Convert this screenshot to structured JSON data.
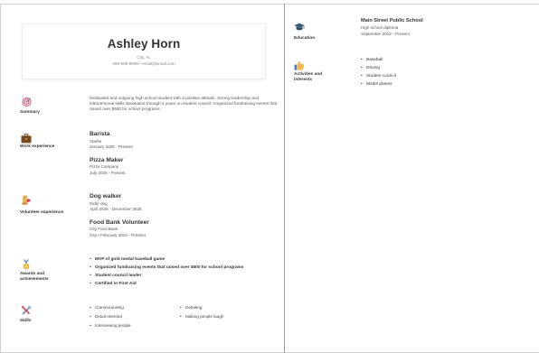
{
  "header": {
    "name": "Ashley Horn",
    "location": "City, AL",
    "contact": "999-999-9999  •  email@email.com"
  },
  "summary": {
    "title": "Summary",
    "icon": "target-icon",
    "text": "Dedicated and outgoing high school student with a positive attitude. Strong leadership and interpersonal skills developed through 2 years on student council. Organized fundraising events that raised over $500 for school programs."
  },
  "work": {
    "title": "Work experience",
    "icon": "briefcase-icon",
    "jobs": [
      {
        "role": "Barista",
        "company": "Starbs",
        "dates": "January 2026 - Present"
      },
      {
        "role": "Pizza Maker",
        "company": "Pizza Company",
        "dates": "July 2025 - Present"
      }
    ]
  },
  "volunteer": {
    "title": "Volunteer experience",
    "icon": "volunteer-hand-icon",
    "jobs": [
      {
        "role": "Dog walker",
        "company": "Elder dog",
        "dates": "April 2025 - December 2025"
      },
      {
        "role": "Food Bank Volunteer",
        "company": "City Food Bank",
        "dates": "City  •  February 2024 - Present"
      }
    ]
  },
  "awards": {
    "title": "Awards and achievements",
    "icon": "medal-icon",
    "items": [
      "MVP of gold medal baseball game",
      "Organized fundraising events that raised over $500 for school programs",
      "Student council leader",
      "Certified in First Aid"
    ]
  },
  "skills": {
    "title": "Skills",
    "icon": "tools-icon",
    "items": [
      "Communicating",
      "Debating",
      "Detail-oriented",
      "Making people laugh",
      "Interviewing people"
    ]
  },
  "education": {
    "title": "Education",
    "icon": "graduation-cap-icon",
    "school": "Main Street Public School",
    "degree": "High school diploma",
    "dates": "September 2022 - Present"
  },
  "activities": {
    "title": "Activities and interests",
    "icon": "thumbs-up-icon",
    "items": [
      "Baseball",
      "Driving",
      "Student council",
      "Model planes"
    ]
  }
}
